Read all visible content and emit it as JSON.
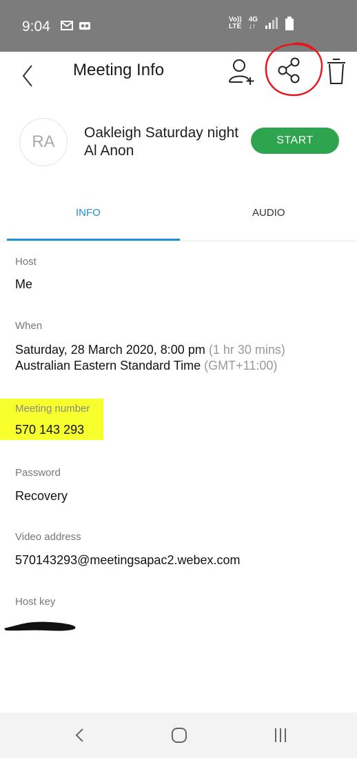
{
  "status_bar": {
    "time": "9:04",
    "left_icons": [
      "mail-icon",
      "voicemail-icon"
    ],
    "volte_label_top": "Vo))",
    "volte_label_bottom": "LTE",
    "network_label": "4G",
    "network_arrows": "↓↑"
  },
  "header": {
    "title": "Meeting Info"
  },
  "meeting": {
    "avatar_initials": "RA",
    "name": "Oakleigh Saturday night Al Anon",
    "start_label": "START",
    "start_color": "#2ea44f"
  },
  "tabs": [
    {
      "label": "INFO",
      "active": true
    },
    {
      "label": "AUDIO",
      "active": false
    }
  ],
  "fields": {
    "host": {
      "label": "Host",
      "value": "Me"
    },
    "when": {
      "label": "When",
      "date": "Saturday, 28 March 2020, 8:00 pm",
      "duration": "(1 hr 30 mins)",
      "timezone": "Australian Eastern Standard Time",
      "gmt": "(GMT+11:00)"
    },
    "meeting_number": {
      "label": "Meeting number",
      "value": "570 143 293"
    },
    "password": {
      "label": "Password",
      "value": "Recovery"
    },
    "video_address": {
      "label": "Video address",
      "value": "570143293@meetingsapac2.webex.com"
    },
    "host_key": {
      "label": "Host key"
    }
  },
  "colors": {
    "accent": "#1f8fcf",
    "highlight": "#f7ff2c",
    "annotation": "#e8151b"
  }
}
